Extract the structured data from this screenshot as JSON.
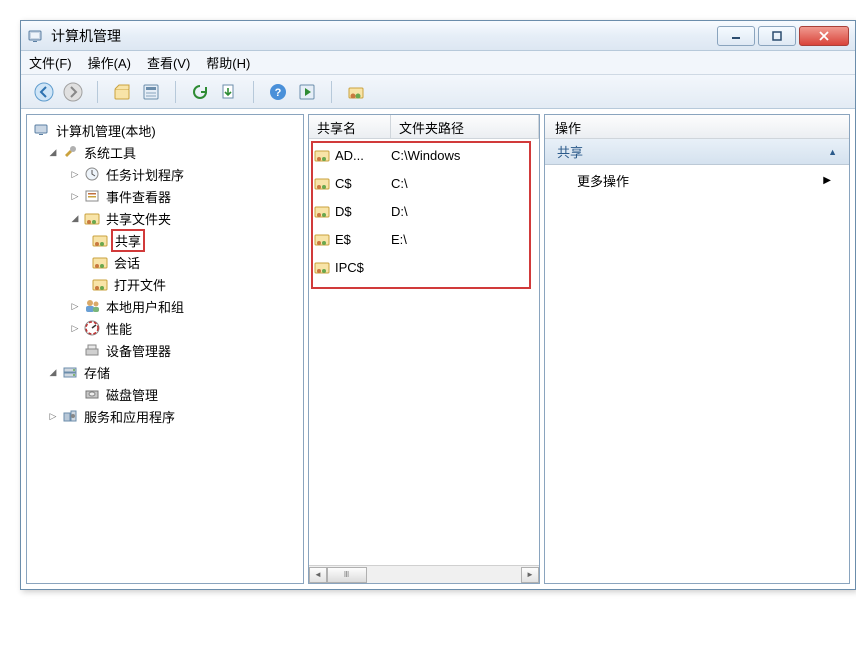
{
  "window": {
    "title": "计算机管理"
  },
  "menu": {
    "file": "文件(F)",
    "action": "操作(A)",
    "view": "查看(V)",
    "help": "帮助(H)"
  },
  "tree": {
    "root": "计算机管理(本地)",
    "systemTools": "系统工具",
    "taskScheduler": "任务计划程序",
    "eventViewer": "事件查看器",
    "sharedFolders": "共享文件夹",
    "shares": "共享",
    "sessions": "会话",
    "openFiles": "打开文件",
    "localUsers": "本地用户和组",
    "performance": "性能",
    "deviceManager": "设备管理器",
    "storage": "存储",
    "diskMgmt": "磁盘管理",
    "servicesApps": "服务和应用程序"
  },
  "list": {
    "col_name": "共享名",
    "col_path": "文件夹路径",
    "rows": [
      {
        "name": "AD...",
        "path": "C:\\Windows"
      },
      {
        "name": "C$",
        "path": "C:\\"
      },
      {
        "name": "D$",
        "path": "D:\\"
      },
      {
        "name": "E$",
        "path": "E:\\"
      },
      {
        "name": "IPC$",
        "path": ""
      }
    ]
  },
  "actions": {
    "header": "操作",
    "section": "共享",
    "more": "更多操作"
  }
}
